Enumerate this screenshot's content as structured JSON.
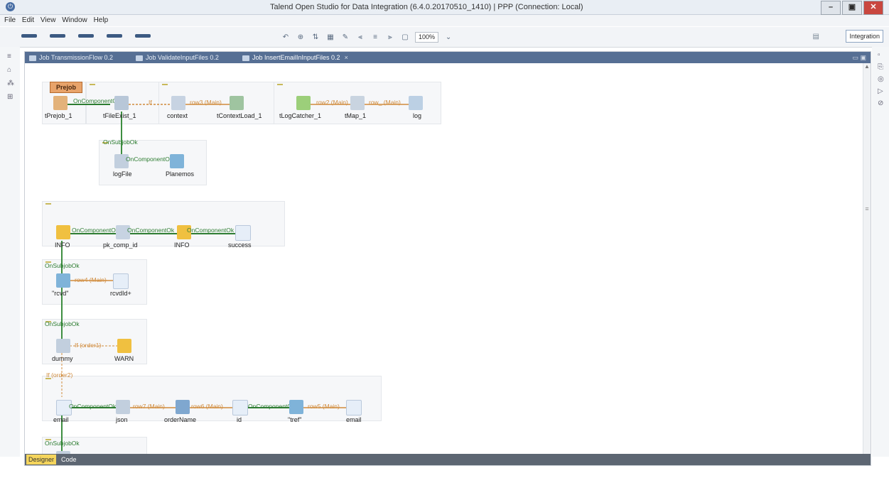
{
  "window": {
    "title": "Talend Open Studio for Data Integration (6.4.0.20170510_1410) | PPP (Connection: Local)"
  },
  "menu": [
    "File",
    "Edit",
    "View",
    "Window",
    "Help"
  ],
  "toolbar": {
    "zoom": "100%",
    "perspective": "Integration"
  },
  "tabs": [
    {
      "label": "Job TransmissionFlow 0.2",
      "active": false
    },
    {
      "label": "Job ValidateInputFiles 0.2",
      "active": false
    },
    {
      "label": "Job InsertEmailInInputFiles 0.2",
      "active": true
    }
  ],
  "bottom_tabs": [
    "Designer",
    "Code"
  ],
  "prejob_label": "Prejob",
  "components": {
    "tPrejob_1": "tPrejob_1",
    "tFileExist_1": "tFileExist_1",
    "context": "context",
    "tContextLoad_1": "tContextLoad_1",
    "tLogCatcher_1": "tLogCatcher_1",
    "tMap_1": "tMap_1",
    "log": "log",
    "logFile": "logFile",
    "Planemos": "Planemos",
    "INFO1": "INFO",
    "pk_comp_id": "pk_comp_id",
    "INFO2": "INFO",
    "success": "success",
    "rcvd": "\"rcvd\"",
    "rcvdId": "rcvdId+",
    "dummy": "dummy",
    "WARN": "WARN",
    "email1": "email",
    "json": "json",
    "orderName": "orderName",
    "id": "id",
    "tref": "\"tref\"",
    "email2": "email"
  },
  "links": {
    "onComponentOk": "OnComponentOk",
    "onSubjobOk": "OnSubjobOk",
    "row2": "row2 (Main)",
    "row3": "row3 (Main)",
    "row": "row_ (Main)",
    "row4": "row4 (Main)",
    "row7": "row7 (Main)",
    "row6": "row6 (Main)",
    "row5": "row5 (Main)",
    "if1": "If (order1)",
    "if2": "If (order2)",
    "if_short": "If"
  },
  "colors": {
    "tabbar": "#566f94",
    "onComponentOk": "#2e7d32",
    "row_link": "#d08b3c",
    "active_tab_underline": "#f1d34a"
  }
}
